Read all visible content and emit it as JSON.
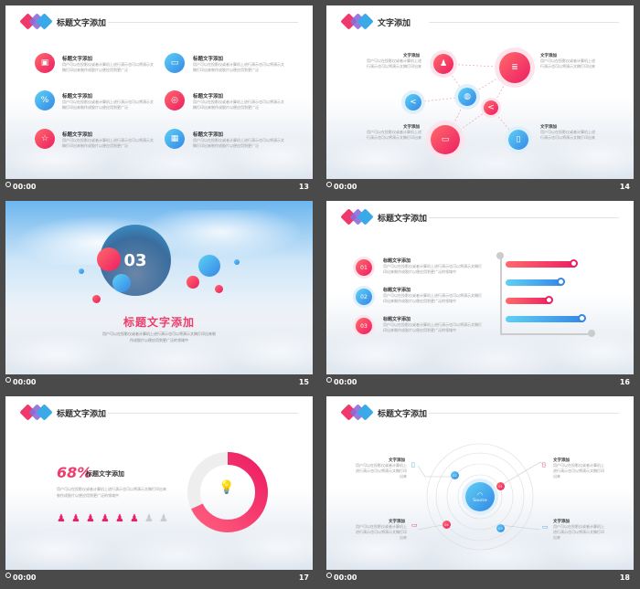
{
  "colors": {
    "red": "#ed1e63",
    "blue": "#3487e6",
    "bar_bg": "#4a4a4a"
  },
  "slides": [
    {
      "number": "13",
      "time": "00:00",
      "title": "标题文字添加",
      "items": [
        {
          "title": "标题文字添加",
          "desc": "用户可以在投影仪或者计算机上进行演示也可以将演示文稿打印出来制作成胶片以便应用到更广泛",
          "icon": "cube-icon"
        },
        {
          "title": "标题文字添加",
          "desc": "用户可以在投影仪或者计算机上进行演示也可以将演示文稿打印出来制作成胶片以便应用到更广泛",
          "icon": "window-icon"
        },
        {
          "title": "标题文字添加",
          "desc": "用户可以在投影仪或者计算机上进行演示也可以将演示文稿打印出来制作成胶片以便应用到更广泛",
          "icon": "percent-icon"
        },
        {
          "title": "标题文字添加",
          "desc": "用户可以在投影仪或者计算机上进行演示也可以将演示文稿打印出来制作成胶片以便应用到更广泛",
          "icon": "target-icon"
        },
        {
          "title": "标题文字添加",
          "desc": "用户可以在投影仪或者计算机上进行演示也可以将演示文稿打印出来制作成胶片以便应用到更广泛",
          "icon": "star-icon"
        },
        {
          "title": "标题文字添加",
          "desc": "用户可以在投影仪或者计算机上进行演示也可以将演示文稿打印出来制作成胶片以便应用到更广泛",
          "icon": "grid-icon"
        }
      ]
    },
    {
      "number": "14",
      "time": "00:00",
      "labels": [
        {
          "title": "文字添加",
          "desc": "用户可以在投影仪或者计算机上进行演示也可以将演示文稿打印出来"
        },
        {
          "title": "文字添加",
          "desc": "用户可以在投影仪或者计算机上进行演示也可以将演示文稿打印出来"
        },
        {
          "title": "文字添加",
          "desc": "用户可以在投影仪或者计算机上进行演示也可以将演示文稿打印出来"
        },
        {
          "title": "文字添加",
          "desc": "用户可以在投影仪或者计算机上进行演示也可以将演示文稿打印出来"
        }
      ]
    },
    {
      "number": "15",
      "time": "00:00",
      "big_number": "03",
      "title": "标题文字添加",
      "desc": "用户可以在投影仪或者计算机上进行演示也可以将演示文稿打印出来制作成胶片以便应用到更广泛的领域中"
    },
    {
      "number": "16",
      "time": "00:00",
      "title": "标题文字添加",
      "items": [
        {
          "num": "01",
          "title": "标题文字添加",
          "desc": "用户可以在投影仪或者计算机上进行演示也可以将演示文稿打印出来制作成胶片以便应用到更广泛的领域中"
        },
        {
          "num": "02",
          "title": "标题文字添加",
          "desc": "用户可以在投影仪或者计算机上进行演示也可以将演示文稿打印出来制作成胶片以便应用到更广泛的领域中"
        },
        {
          "num": "03",
          "title": "标题文字添加",
          "desc": "用户可以在投影仪或者计算机上进行演示也可以将演示文稿打印出来制作成胶片以便应用到更广泛的领域中"
        }
      ],
      "bars": [
        0.85,
        0.7,
        0.55,
        0.95
      ]
    },
    {
      "number": "17",
      "time": "00:00",
      "title": "标题文字添加",
      "percent": "68%",
      "subtitle": "标题文字添加",
      "desc": "用户可以在投影仪或者计算机上进行演示也可以将演示文稿打印出来制作成胶片以便应用到更广泛的领域中",
      "ring_fraction": 0.68,
      "people_total": 8,
      "people_active": 6
    },
    {
      "number": "18",
      "time": "00:00",
      "title": "标题文字添加",
      "center": "Source",
      "nodes": [
        "01",
        "02",
        "03",
        "04"
      ],
      "labels": [
        {
          "title": "文字添加",
          "desc": "用户可以在投影仪或者计算机上进行演示也可以将演示文稿打印出来"
        },
        {
          "title": "文字添加",
          "desc": "用户可以在投影仪或者计算机上进行演示也可以将演示文稿打印出来"
        },
        {
          "title": "文字添加",
          "desc": "用户可以在投影仪或者计算机上进行演示也可以将演示文稿打印出来"
        },
        {
          "title": "文字添加",
          "desc": "用户可以在投影仪或者计算机上进行演示也可以将演示文稿打印出来"
        }
      ]
    }
  ]
}
